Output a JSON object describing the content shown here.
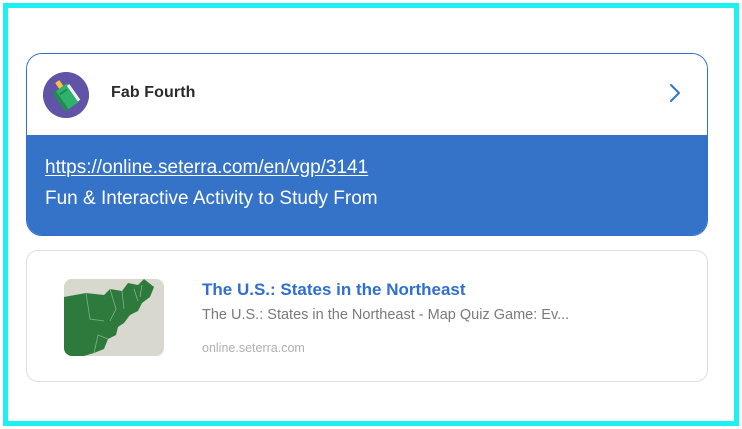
{
  "post": {
    "author": "Fab Fourth",
    "avatar_icon": "book-icon",
    "chevron_icon": "chevron-right-icon",
    "link_url": "https://online.seterra.com/en/vgp/3141",
    "description": "Fun & Interactive Activity to Study From"
  },
  "preview": {
    "title": "The U.S.: States in the Northeast",
    "description": "The U.S.: States in the Northeast - Map Quiz Game: Ev...",
    "domain": "online.seterra.com",
    "thumbnail_icon": "northeast-map-thumbnail"
  },
  "colors": {
    "frame_border": "#1cf0f0",
    "accent_blue": "#3573c9",
    "title_blue": "#2f6fcf",
    "avatar_bg": "#6153a6",
    "map_green": "#2e7a3c"
  }
}
